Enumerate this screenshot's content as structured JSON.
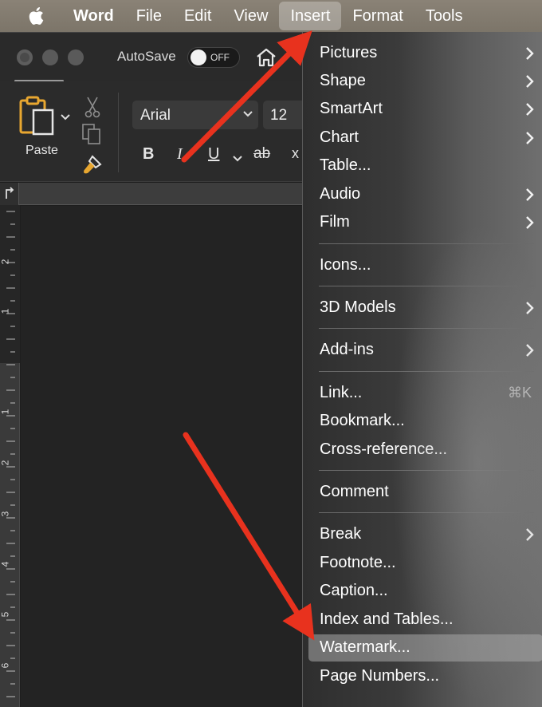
{
  "menubar": {
    "app_name": "Word",
    "items": [
      "File",
      "Edit",
      "View",
      "Insert",
      "Format",
      "Tools"
    ]
  },
  "toolbar": {
    "autosave_label": "AutoSave",
    "autosave_state": "OFF"
  },
  "ribbon": {
    "paste_label": "Paste",
    "font_name": "Arial",
    "font_size": "12",
    "bold": "B",
    "italic": "I",
    "underline": "U",
    "strikethrough": "ab",
    "subscript": "x"
  },
  "ruler": {
    "vertical_numbers": [
      "2",
      "1",
      "1",
      "2",
      "3",
      "4",
      "5",
      "6"
    ]
  },
  "insert_menu": {
    "items": [
      {
        "label": "Pictures",
        "submenu": true
      },
      {
        "label": "Shape",
        "submenu": true
      },
      {
        "label": "SmartArt",
        "submenu": true
      },
      {
        "label": "Chart",
        "submenu": true
      },
      {
        "label": "Table...",
        "submenu": false
      },
      {
        "label": "Audio",
        "submenu": true
      },
      {
        "label": "Film",
        "submenu": true
      },
      {
        "label": "Icons...",
        "submenu": false
      },
      {
        "label": "3D Models",
        "submenu": true
      },
      {
        "label": "Add-ins",
        "submenu": true
      },
      {
        "label": "Link...",
        "submenu": false,
        "shortcut": "⌘K"
      },
      {
        "label": "Bookmark...",
        "submenu": false
      },
      {
        "label": "Cross-reference...",
        "submenu": false
      },
      {
        "label": "Comment",
        "submenu": false
      },
      {
        "label": "Break",
        "submenu": true
      },
      {
        "label": "Footnote...",
        "submenu": false
      },
      {
        "label": "Caption...",
        "submenu": false
      },
      {
        "label": "Index and Tables...",
        "submenu": false
      },
      {
        "label": "Watermark...",
        "submenu": false,
        "highlighted": true
      },
      {
        "label": "Page Numbers...",
        "submenu": false
      }
    ]
  },
  "colors": {
    "annotation_arrow": "#e8321e",
    "menubar_bg": "#857d71",
    "menu_highlight": "#9a9a9a"
  }
}
